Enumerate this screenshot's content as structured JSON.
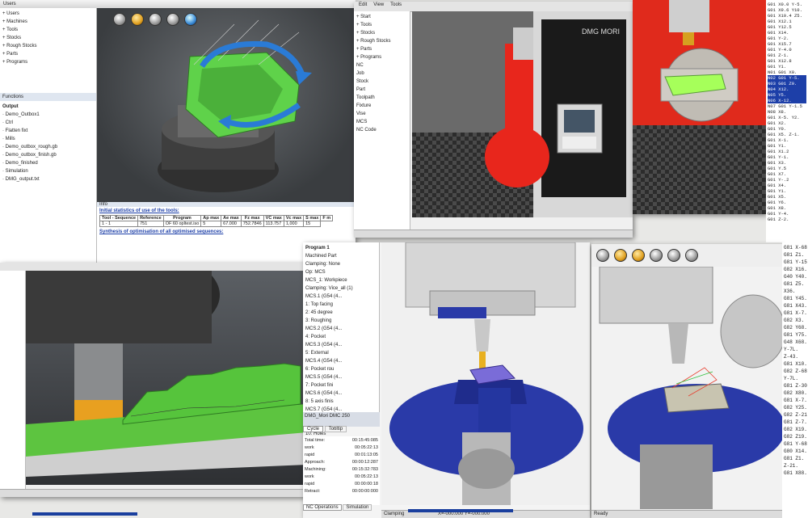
{
  "panel_a": {
    "tree_title": "Users",
    "tree_items": [
      "Users",
      "Machines",
      "Tools",
      "Stocks",
      "Rough Stocks",
      "Parts",
      "Programs"
    ],
    "functions_label": "Functions",
    "output_label": "Output",
    "output_items": [
      "Demo_Outbox1",
      "Ctrl",
      "Flatten fixt",
      "Mills",
      "Demo_outbox_rough.gb",
      "Demo_outbox_finish.gb",
      "Demo_finished",
      "Simulation",
      "DMG_output.txt"
    ],
    "info_label": "Info",
    "stats_heading": "Initial statistics of use of the tools:",
    "stats_headers": [
      "Tool - Sequence",
      "Reference",
      "Program",
      "Ap max",
      "Ae max",
      "Fz max",
      "VC max",
      "Vc max",
      "S max",
      "F m"
    ],
    "stats_row": [
      "1 - 1",
      "751",
      "OF 60 opltest.iso",
      "5",
      "67.000",
      "752.7846",
      "113.757",
      "1,000",
      "15"
    ],
    "footer_heading": "Synthesis of optimisation of all optimised sequences:",
    "colors": {
      "part": "#5fd24a",
      "rotate_arrow": "#2a7bd6",
      "viewport": "#4a4e52"
    }
  },
  "panel_b": {
    "menu_items": [
      "Edit",
      "View",
      "Tools"
    ],
    "tree_items": [
      "Start",
      "Tools",
      "Stocks",
      "Rough Stocks",
      "Parts",
      "Programs"
    ],
    "subtree_items": [
      "NC",
      "Job",
      "Stock",
      "Part",
      "Toolpath",
      "Fixture",
      "Vise",
      "MCS",
      "NC Code"
    ],
    "machine_brand": "DMG MORI",
    "colors": {
      "column": "#e8261c",
      "floor": "#3a3a3a"
    }
  },
  "panel_c": {
    "colors": {
      "part": "#a6ff5a",
      "column": "#e8261c",
      "fixture": "#d0ccc4"
    }
  },
  "gcode_right": {
    "lines": [
      "G01 X0.0 Y-5.",
      "G01 X9.6 Y10.",
      "G01 X10.4 Z5.",
      "G01 X12.1",
      "G01 Y12.5",
      "G01 X14.",
      "G01 Y-2.",
      "G01 X15.7",
      "G01 Y-4.0",
      "G01 Z-1.",
      "G01 X12.8",
      "G01 Y1.",
      "N01 G01 X0.",
      "N02 G01 Y-5.",
      "N03 G01 Z0.",
      "N04 X12.",
      "N05 Y5.",
      "N06 X-12.",
      "N07 G01 Y-1.5",
      "N08 X8.",
      "G01 X-5. Y2.",
      "G01 X2.",
      "G01 Y0.",
      "G01 X5. Z-1.",
      "G01 X-1.",
      "G01 Y1.",
      "G01 X1.2",
      "G01 Y-1.",
      "G01 X3.",
      "G01 Y.5",
      "G01 X7.",
      "G01 Y-.2",
      "G01 X4.",
      "G01 Y1.",
      "G01 X5.",
      "G01 Y6.",
      "G01 X8.",
      "G01 Y-4.",
      "G01 Z-2."
    ],
    "selected_indices": [
      13,
      14,
      15,
      16,
      17
    ]
  },
  "panel_d": {
    "colors": {
      "part": "#56c43c",
      "spindle_band": "#e8a020",
      "table": "#c8c8c8"
    }
  },
  "panel_e": {
    "tree_root": "Program 1",
    "tree_items": [
      "Machined Part",
      "Clamping: None",
      "Op: MCS",
      "MCS_1: Workpiece",
      "Clamping: Vice_all (1)",
      "MCS.1 (G54 (4...",
      "1: Top facing",
      "2: 45 degree",
      "3: Roughing",
      "MCS.2 (G54 (4...",
      "4: Pocket",
      "MCS.3 (G54 (4...",
      "5: External",
      "MCS.4 (G54 (4...",
      "6: Pocket rou",
      "MCS.5 (G54 (4...",
      "7: Pocket fini",
      "MCS.6 (G54 (4...",
      "8: 5 axis finis",
      "MCS.7 (G54 (4...",
      "9: Holes at",
      "MCS.8 (G54 (4...",
      "10: Holes"
    ],
    "machine_label": "DMG_Mori DMC 250",
    "tabs": [
      "Cycle",
      "Tooltip"
    ],
    "times": [
      {
        "label": "Total time:",
        "value": "00:15:45:085"
      },
      {
        "label": "work",
        "value": "00:05:22:13"
      },
      {
        "label": "rapid",
        "value": "00:01:13:05"
      },
      {
        "label": "Approach:",
        "value": "00:00:12:287"
      },
      {
        "label": "Machining:",
        "value": "00:15:32:783"
      },
      {
        "label": "work",
        "value": "00:05:22:13"
      },
      {
        "label": "rapid",
        "value": "00:00:00:18"
      },
      {
        "label": "Retract:",
        "value": "00:00:00:000"
      }
    ],
    "bottom_tabs": [
      "NC Operations",
      "Simulation"
    ],
    "status_text": "Clamping",
    "coord_readout": "X=-000.000 Y=-000.000",
    "colors": {
      "table": "#2a3aa8",
      "fixture": "#1f2c8c",
      "part": "#7a6cd8"
    }
  },
  "panel_f": {
    "gcode_lines": [
      "G81 X-68.",
      "G81 Z1.",
      "G81 Y-15.",
      "G82 X16.",
      "G40 Y40.",
      "G81 Z5.",
      "X36.",
      "G81 Y45.",
      "G81 X43.",
      "G81 X-7.",
      "G82 X3.",
      "G82 Y68.",
      "G81 Y75.",
      "G48 X68.",
      "Y-7L.",
      "Z-43.",
      "G81 X10.",
      "G82 Z-68.",
      "Y-7L.",
      "G81 Z-30.",
      "G82 X80.",
      "G81 X-7.",
      "G82 Y25.",
      "G82 Z-21.",
      "G81 Z-7.",
      "G82 X19.",
      "G82 Z19.",
      "G81 Y-68.",
      "G80 X14.",
      "G81 Z1.",
      "Z-21.",
      "G81 X88."
    ],
    "status_left": "Ready",
    "colors": {
      "table": "#2a3aa8",
      "part": "#c8c4b0"
    }
  }
}
